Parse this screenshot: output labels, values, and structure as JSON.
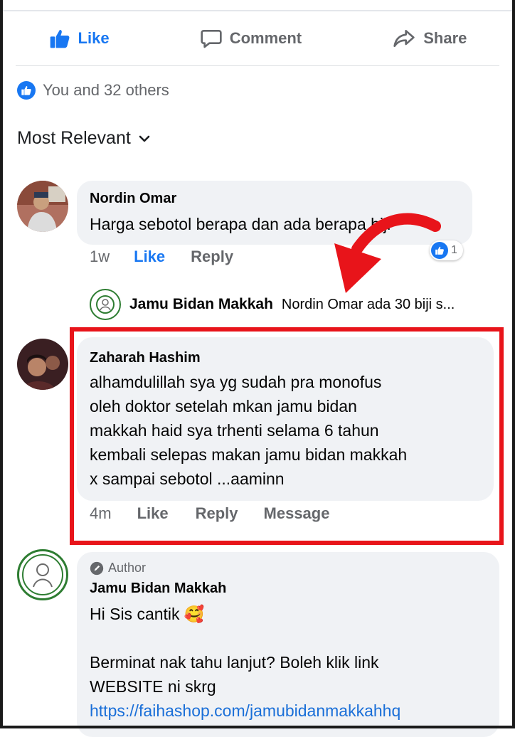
{
  "actions": {
    "like": "Like",
    "comment": "Comment",
    "share": "Share"
  },
  "reactions": {
    "summary": "You and 32 others"
  },
  "sort": {
    "label": "Most Relevant"
  },
  "comments": [
    {
      "author": "Nordin Omar",
      "text": "Harga sebotol berapa dan ada berapa biji",
      "time": "1w",
      "like": "Like",
      "reply": "Reply",
      "reaction_count": "1",
      "reply_preview": {
        "author": "Jamu Bidan Makkah",
        "text": "Nordin Omar ada 30 biji s..."
      }
    },
    {
      "author": "Zaharah Hashim",
      "text": "alhamdulillah  sya yg  sudah pra monofus\noleh doktor setelah mkan jamu bidan\nmakkah haid sya trhenti selama 6 tahun\nkembali selepas makan jamu bidan makkah\nx sampai sebotol ...aaminn",
      "time": "4m",
      "like": "Like",
      "reply": "Reply",
      "message": "Message"
    },
    {
      "author_tag": "Author",
      "author": "Jamu Bidan Makkah",
      "greeting": "Hi Sis cantik 🥰",
      "line1": "Berminat nak tahu lanjut? Boleh klik link",
      "line2": "WEBSITE ni skrg",
      "link": "https://faihashop.com/jamubidanmakkahhq"
    }
  ],
  "colors": {
    "accent": "#1877f2",
    "highlight": "#e8141a",
    "bubble": "#f0f2f5"
  }
}
